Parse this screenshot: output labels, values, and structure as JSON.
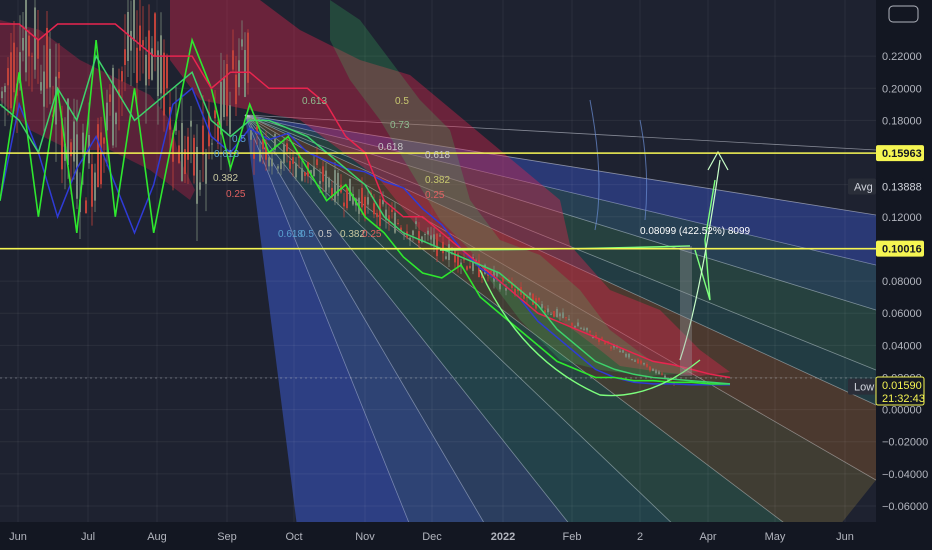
{
  "chart_data": {
    "type": "line",
    "title": "",
    "xlabel": "",
    "ylabel": "",
    "ylim": [
      -0.07,
      0.245
    ],
    "x_ticks": [
      "Jun",
      "Jul",
      "Aug",
      "Sep",
      "Oct",
      "Nov",
      "Dec",
      "2022",
      "Feb",
      "2",
      "Apr",
      "May",
      "Jun"
    ],
    "y_ticks": [
      0.22,
      0.2,
      0.18,
      0.16,
      0.14,
      0.12,
      0.1,
      0.08,
      0.06,
      0.04,
      0.02,
      0.0,
      -0.02,
      -0.04,
      -0.06
    ],
    "y_tick_labels": [
      "0.22000",
      "0.20000",
      "0.18000",
      "0.16000",
      "0.14000",
      "0.12000",
      "0.10000",
      "0.08000",
      "0.06000",
      "0.04000",
      "0.02000",
      "0.00000",
      "−0.02000",
      "−0.04000",
      "−0.06000"
    ],
    "grid": true,
    "horizontal_levels": [
      {
        "value": 0.15963,
        "label": "0.15963",
        "color": "#f5f552"
      },
      {
        "value": 0.10016,
        "label": "0.10016",
        "color": "#f5f552"
      }
    ],
    "price_tags": [
      {
        "name": "Avg",
        "value": 0.13888,
        "label": "0.13888"
      },
      {
        "name": "Low",
        "value": 0.01429,
        "label": "0.01429"
      }
    ],
    "last_price": {
      "value": 0.0159,
      "label": "0.01590",
      "countdown": "21:32:43",
      "color": "#f5f552"
    },
    "fib_labels": [
      "0.613",
      "0.5",
      "0.613",
      "0.382",
      "0.25",
      "0.5",
      "0.618",
      "0.382",
      "0.25",
      "0.5",
      "0.618",
      "0.5",
      "0.382",
      "0.25",
      "0.73",
      "0.618"
    ],
    "measure_annotation": "0.08099 (422.52%) 8099",
    "series": [
      {
        "kind": "ema",
        "color": "#2f3bd6",
        "values": [
          0.13,
          0.19,
          0.16,
          0.12,
          0.15,
          0.17,
          0.14,
          0.11,
          0.14,
          0.19,
          0.2,
          0.17,
          0.16,
          0.175,
          0.168,
          0.172,
          0.16,
          0.155,
          0.15,
          0.148,
          0.142,
          0.138,
          0.125,
          0.115,
          0.1,
          0.088,
          0.08,
          0.07,
          0.055,
          0.045,
          0.035,
          0.025,
          0.02,
          0.017,
          0.016,
          0.016,
          0.0155,
          0.0155,
          0.0155
        ]
      },
      {
        "kind": "fast",
        "color": "#2ee82e",
        "values": [
          0.13,
          0.21,
          0.12,
          0.2,
          0.11,
          0.23,
          0.12,
          0.2,
          0.11,
          0.17,
          0.23,
          0.2,
          0.15,
          0.19,
          0.16,
          0.17,
          0.15,
          0.13,
          0.14,
          0.12,
          0.11,
          0.095,
          0.085,
          0.082,
          0.09,
          0.07,
          0.06,
          0.05,
          0.04,
          0.03,
          0.025,
          0.02,
          0.02,
          0.018,
          0.018,
          0.017,
          0.017,
          0.016,
          0.016
        ]
      },
      {
        "kind": "resistance",
        "color": "#e8254f",
        "values": [
          0.24,
          0.24,
          0.23,
          0.24,
          0.24,
          0.24,
          0.24,
          0.23,
          0.22,
          0.22,
          0.22,
          0.2,
          0.21,
          0.21,
          0.2,
          0.2,
          0.2,
          0.19,
          0.17,
          0.16,
          0.13,
          0.12,
          0.12,
          0.11,
          0.1,
          0.09,
          0.08,
          0.07,
          0.06,
          0.055,
          0.05,
          0.045,
          0.04,
          0.035,
          0.03,
          0.028,
          0.025,
          0.022,
          0.02
        ]
      },
      {
        "kind": "baseline",
        "color": "#3dd36b",
        "values": [
          0.19,
          0.18,
          0.16,
          0.2,
          0.18,
          0.22,
          0.2,
          0.18,
          0.19,
          0.2,
          0.21,
          0.18,
          0.17,
          0.18,
          0.18,
          0.175,
          0.17,
          0.16,
          0.15,
          0.14,
          0.12,
          0.11,
          0.105,
          0.1,
          0.095,
          0.09,
          0.085,
          0.075,
          0.065,
          0.05,
          0.04,
          0.03,
          0.025,
          0.022,
          0.02,
          0.019,
          0.018,
          0.017,
          0.016
        ]
      }
    ]
  },
  "ui": {
    "toggle_label": ""
  }
}
